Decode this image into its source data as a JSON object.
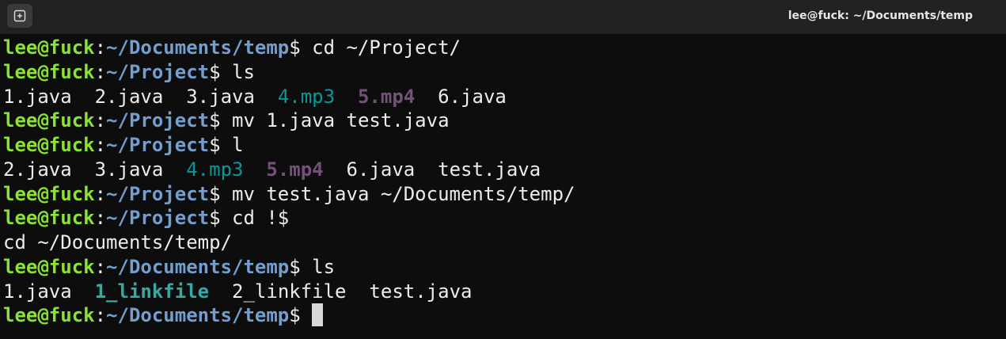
{
  "window": {
    "title": "lee@fuck: ~/Documents/temp",
    "new_tab_icon": "new-tab-icon"
  },
  "colors": {
    "user_host": "#8ae234",
    "path": "#729fcf",
    "audio_file": "#06989a",
    "video_file": "#75507b",
    "symlink": "#34aaa5",
    "text": "#ececec",
    "background": "#0d0d0d"
  },
  "terminal": {
    "lines": [
      {
        "type": "prompt",
        "user": "lee@fuck",
        "path": "~/Documents/temp",
        "command": " cd ~/Project/"
      },
      {
        "type": "prompt",
        "user": "lee@fuck",
        "path": "~/Project",
        "command": " ls"
      },
      {
        "type": "listing",
        "entries": [
          {
            "name": "1.java",
            "kind": "plain",
            "sep": "  "
          },
          {
            "name": "2.java",
            "kind": "plain",
            "sep": "  "
          },
          {
            "name": "3.java",
            "kind": "plain",
            "sep": "  "
          },
          {
            "name": "4.mp3",
            "kind": "audio",
            "sep": "  "
          },
          {
            "name": "5.mp4",
            "kind": "video",
            "sep": "  "
          },
          {
            "name": "6.java",
            "kind": "plain",
            "sep": ""
          }
        ]
      },
      {
        "type": "prompt",
        "user": "lee@fuck",
        "path": "~/Project",
        "command": " mv 1.java test.java"
      },
      {
        "type": "prompt",
        "user": "lee@fuck",
        "path": "~/Project",
        "command": " l"
      },
      {
        "type": "listing",
        "entries": [
          {
            "name": "2.java",
            "kind": "plain",
            "sep": "  "
          },
          {
            "name": "3.java",
            "kind": "plain",
            "sep": "  "
          },
          {
            "name": "4.mp3",
            "kind": "audio",
            "sep": "  "
          },
          {
            "name": "5.mp4",
            "kind": "video",
            "sep": "  "
          },
          {
            "name": "6.java",
            "kind": "plain",
            "sep": "  "
          },
          {
            "name": "test.java",
            "kind": "plain",
            "sep": ""
          }
        ]
      },
      {
        "type": "prompt",
        "user": "lee@fuck",
        "path": "~/Project",
        "command": " mv test.java ~/Documents/temp/"
      },
      {
        "type": "prompt",
        "user": "lee@fuck",
        "path": "~/Project",
        "command": " cd !$"
      },
      {
        "type": "output",
        "text": "cd ~/Documents/temp/"
      },
      {
        "type": "prompt",
        "user": "lee@fuck",
        "path": "~/Documents/temp",
        "command": " ls"
      },
      {
        "type": "listing",
        "entries": [
          {
            "name": "1.java",
            "kind": "plain",
            "sep": "  "
          },
          {
            "name": "1_linkfile",
            "kind": "link",
            "sep": "  "
          },
          {
            "name": "2_linkfile",
            "kind": "plain",
            "sep": "  "
          },
          {
            "name": "test.java",
            "kind": "plain",
            "sep": ""
          }
        ]
      },
      {
        "type": "prompt",
        "user": "lee@fuck",
        "path": "~/Documents/temp",
        "command": " ",
        "cursor": true
      }
    ]
  }
}
